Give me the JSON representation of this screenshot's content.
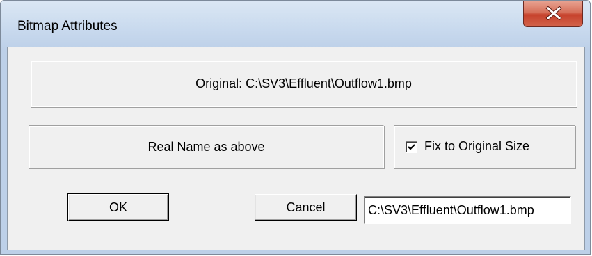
{
  "window": {
    "title": "Bitmap Attributes"
  },
  "original_label": "Original: C:\\SV3\\Effluent\\Outflow1.bmp",
  "real_name_label": "Real Name as above",
  "fix_size": {
    "label": "Fix to Original Size",
    "checked": true
  },
  "buttons": {
    "ok": "OK",
    "cancel": "Cancel"
  },
  "path_field": {
    "value": "C:\\SV3\\Effluent\\Outflow1.bmp"
  },
  "icons": {
    "close": "close-icon",
    "check": "check-icon"
  },
  "colors": {
    "close_button": "#c6422c",
    "dialog_face": "#f0f0f0",
    "frame": "#bdd0e8"
  }
}
